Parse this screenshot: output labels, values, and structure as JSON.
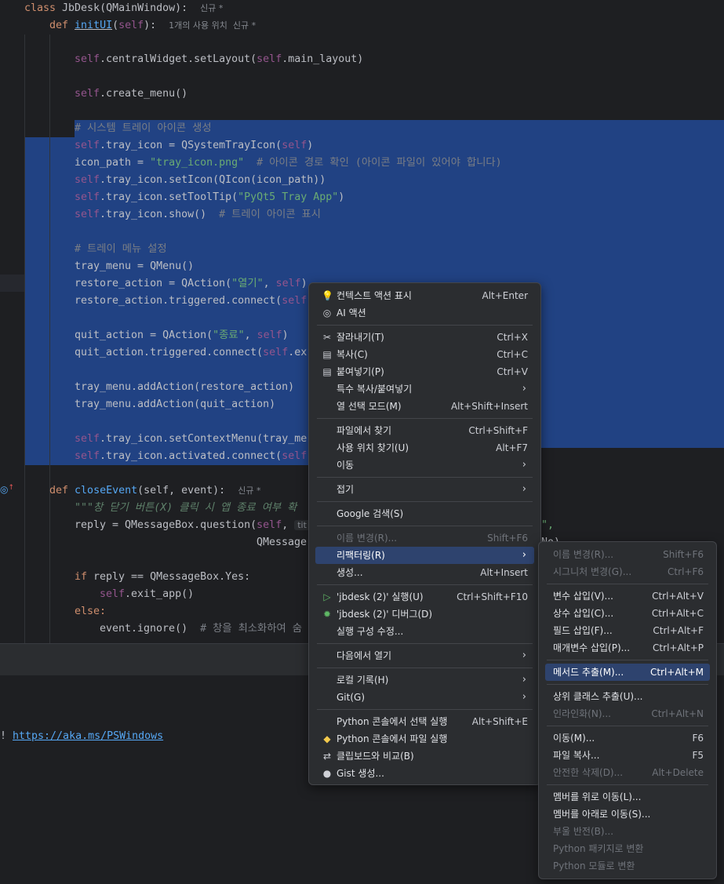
{
  "colors": {
    "selection": "#214283",
    "menu_bg": "#2b2d30",
    "menu_highlight": "#2e436e",
    "keyword": "#cf8e6d",
    "self": "#94558d",
    "string": "#6aab73",
    "function": "#56a8f5",
    "comment": "#7a7e85"
  },
  "code": {
    "l_class": {
      "kw": "class",
      "name": " JbDesk(QMainWindow):",
      "hint": "신규 *"
    },
    "l_def_init": {
      "kw": "def",
      "name": "initUI",
      "args_open": "(",
      "self": "self",
      "args_close": "):",
      "hint": "1개의 사용 위치  신규 *"
    },
    "l_setlayout": {
      "self1": "self",
      "t1": ".centralWidget.setLayout(",
      "self2": "self",
      "t2": ".main_layout)"
    },
    "l_create_menu": {
      "self": "self",
      "t": ".create_menu()"
    },
    "l_cmt1": "# 시스템 트레이 아이콘 생성",
    "l_tray_icon": {
      "self1": "self",
      "t1": ".tray_icon = QSystemTrayIcon(",
      "self2": "self",
      "t2": ")"
    },
    "l_icon_path": {
      "t1": "icon_path = ",
      "str": "\"tray_icon.png\"",
      "cmt": "  # 아이콘 경로 확인 (아이콘 파일이 있어야 합니다)"
    },
    "l_seticon": {
      "self": "self",
      "t": ".tray_icon.setIcon(QIcon(icon_path))"
    },
    "l_settooltip": {
      "self": "self",
      "t1": ".tray_icon.setToolTip(",
      "str": "\"PyQt5 Tray App\"",
      "t2": ")"
    },
    "l_show": {
      "self": "self",
      "t": ".tray_icon.show()",
      "cmt": "  # 트레이 아이콘 표시"
    },
    "l_cmt2": "# 트레이 메뉴 설정",
    "l_tray_menu": "tray_menu = QMenu()",
    "l_restore_action": {
      "t1": "restore_action = QAction(",
      "str": "\"열기\"",
      "t2": ", ",
      "self": "self",
      "t3": ")"
    },
    "l_restore_conn": {
      "t1": "restore_action.triggered.connect(",
      "self": "self"
    },
    "l_quit_action": {
      "t1": "quit_action = QAction(",
      "str": "\"종료\"",
      "t2": ", ",
      "self": "self",
      "t3": ")"
    },
    "l_quit_conn": {
      "t1": "quit_action.triggered.connect(",
      "self": "self",
      "t2": ".ex"
    },
    "l_add_restore": "tray_menu.addAction(restore_action)",
    "l_add_quit": "tray_menu.addAction(quit_action)",
    "l_setcontext": {
      "self": "self",
      "t": ".tray_icon.setContextMenu(tray_me"
    },
    "l_activated": {
      "self": "self",
      "t1": ".tray_icon.activated.connect(",
      "self2": "self"
    },
    "l_def_close": {
      "kw": "def",
      "name": "closeEvent",
      "args": "(self, event):",
      "hint": "신규 *"
    },
    "l_doc": "\"\"\"창 닫기 버튼(X) 클릭 시 앱 종료 여부 확",
    "l_reply": {
      "t1": "reply = QMessageBox.question(",
      "self": "self",
      "t2": ", ",
      "param_hint": "tit",
      "tail": "\","
    },
    "l_qmessage": {
      "t": "QMessage",
      "tail": "No)"
    },
    "l_if": {
      "kw": "if",
      "t": " reply == QMessageBox.Yes:"
    },
    "l_exit": {
      "self": "self",
      "t": ".exit_app()"
    },
    "l_else": "else:",
    "l_ignore": {
      "t": "event.ignore()",
      "cmt": "  # 창을 최소화하여 숨"
    }
  },
  "terminal": {
    "prefix": "! ",
    "link": "https://aka.ms/PSWindows"
  },
  "context_menu": {
    "items": [
      {
        "icon": "💡",
        "icon_name": "bulb-icon",
        "label": "컨텍스트 액션 표시",
        "shortcut": "Alt+Enter"
      },
      {
        "icon": "◎",
        "icon_name": "ai-icon",
        "label": "AI 액션",
        "shortcut": ""
      },
      {
        "sep": true
      },
      {
        "icon": "✂",
        "icon_name": "scissors-icon",
        "label": "잘라내기(T)",
        "shortcut": "Ctrl+X"
      },
      {
        "icon": "▤",
        "icon_name": "copy-icon",
        "label": "복사(C)",
        "shortcut": "Ctrl+C"
      },
      {
        "icon": "▤",
        "icon_name": "paste-icon",
        "label": "붙여넣기(P)",
        "shortcut": "Ctrl+V"
      },
      {
        "icon": "",
        "label": "특수 복사/붙여넣기",
        "shortcut": "",
        "submenu": true
      },
      {
        "icon": "",
        "label": "열 선택 모드(M)",
        "shortcut": "Alt+Shift+Insert"
      },
      {
        "sep": true
      },
      {
        "icon": "",
        "label": "파일에서 찾기",
        "shortcut": "Ctrl+Shift+F"
      },
      {
        "icon": "",
        "label": "사용 위치 찾기(U)",
        "shortcut": "Alt+F7"
      },
      {
        "icon": "",
        "label": "이동",
        "shortcut": "",
        "submenu": true
      },
      {
        "sep": true
      },
      {
        "icon": "",
        "label": "접기",
        "shortcut": "",
        "submenu": true
      },
      {
        "sep": true
      },
      {
        "icon": "",
        "label": "Google 검색(S)",
        "shortcut": ""
      },
      {
        "sep": true
      },
      {
        "icon": "",
        "label": "이름 변경(R)...",
        "shortcut": "Shift+F6",
        "disabled": true
      },
      {
        "icon": "",
        "label": "리팩터링(R)",
        "shortcut": "",
        "submenu": true,
        "highlight": true
      },
      {
        "icon": "",
        "label": "생성...",
        "shortcut": "Alt+Insert"
      },
      {
        "sep": true
      },
      {
        "icon": "▷",
        "icon_name": "run-icon",
        "label": "'jbdesk (2)' 실행(U)",
        "shortcut": "Ctrl+Shift+F10",
        "color": "#5fb865"
      },
      {
        "icon": "✹",
        "icon_name": "debug-icon",
        "label": "'jbdesk (2)' 디버그(D)",
        "shortcut": "",
        "color": "#5fb865"
      },
      {
        "icon": "",
        "label": "실행 구성 수정...",
        "shortcut": ""
      },
      {
        "sep": true
      },
      {
        "icon": "",
        "label": "다음에서 열기",
        "shortcut": "",
        "submenu": true
      },
      {
        "sep": true
      },
      {
        "icon": "",
        "label": "로컬 기록(H)",
        "shortcut": "",
        "submenu": true
      },
      {
        "icon": "",
        "label": "Git(G)",
        "shortcut": "",
        "submenu": true
      },
      {
        "sep": true
      },
      {
        "icon": "",
        "label": "Python 콘솔에서 선택 실행",
        "shortcut": "Alt+Shift+E"
      },
      {
        "icon": "◆",
        "icon_name": "python-icon",
        "label": "Python 콘솔에서 파일 실행",
        "shortcut": "",
        "color": "#f2c94c"
      },
      {
        "icon": "⇄",
        "icon_name": "compare-clipboard-icon",
        "label": "클립보드와 비교(B)",
        "shortcut": ""
      },
      {
        "icon": "●",
        "icon_name": "github-icon",
        "label": "Gist 생성...",
        "shortcut": ""
      }
    ]
  },
  "refactor_submenu": {
    "items": [
      {
        "label": "이름 변경(R)...",
        "shortcut": "Shift+F6",
        "disabled": true
      },
      {
        "label": "시그니처 변경(G)...",
        "shortcut": "Ctrl+F6",
        "disabled": true
      },
      {
        "sep": true
      },
      {
        "label": "변수 삽입(V)...",
        "shortcut": "Ctrl+Alt+V"
      },
      {
        "label": "상수 삽입(C)...",
        "shortcut": "Ctrl+Alt+C"
      },
      {
        "label": "필드 삽입(F)...",
        "shortcut": "Ctrl+Alt+F"
      },
      {
        "label": "매개변수 삽입(P)...",
        "shortcut": "Ctrl+Alt+P"
      },
      {
        "sep": true
      },
      {
        "label": "메서드 추출(M)...",
        "shortcut": "Ctrl+Alt+M",
        "highlight": true
      },
      {
        "sep": true
      },
      {
        "label": "상위 클래스 추출(U)...",
        "shortcut": ""
      },
      {
        "label": "인라인화(N)...",
        "shortcut": "Ctrl+Alt+N",
        "disabled": true
      },
      {
        "sep": true
      },
      {
        "label": "이동(M)...",
        "shortcut": "F6"
      },
      {
        "label": "파일 복사...",
        "shortcut": "F5"
      },
      {
        "label": "안전한 삭제(D)...",
        "shortcut": "Alt+Delete",
        "disabled": true
      },
      {
        "sep": true
      },
      {
        "label": "멤버를 위로 이동(L)...",
        "shortcut": ""
      },
      {
        "label": "멤버를 아래로 이동(S)...",
        "shortcut": ""
      },
      {
        "label": "부울 반전(B)...",
        "shortcut": "",
        "disabled": true
      },
      {
        "label": "Python 패키지로 변환",
        "shortcut": "",
        "disabled": true
      },
      {
        "label": "Python 모듈로 변환",
        "shortcut": "",
        "disabled": true
      }
    ]
  }
}
